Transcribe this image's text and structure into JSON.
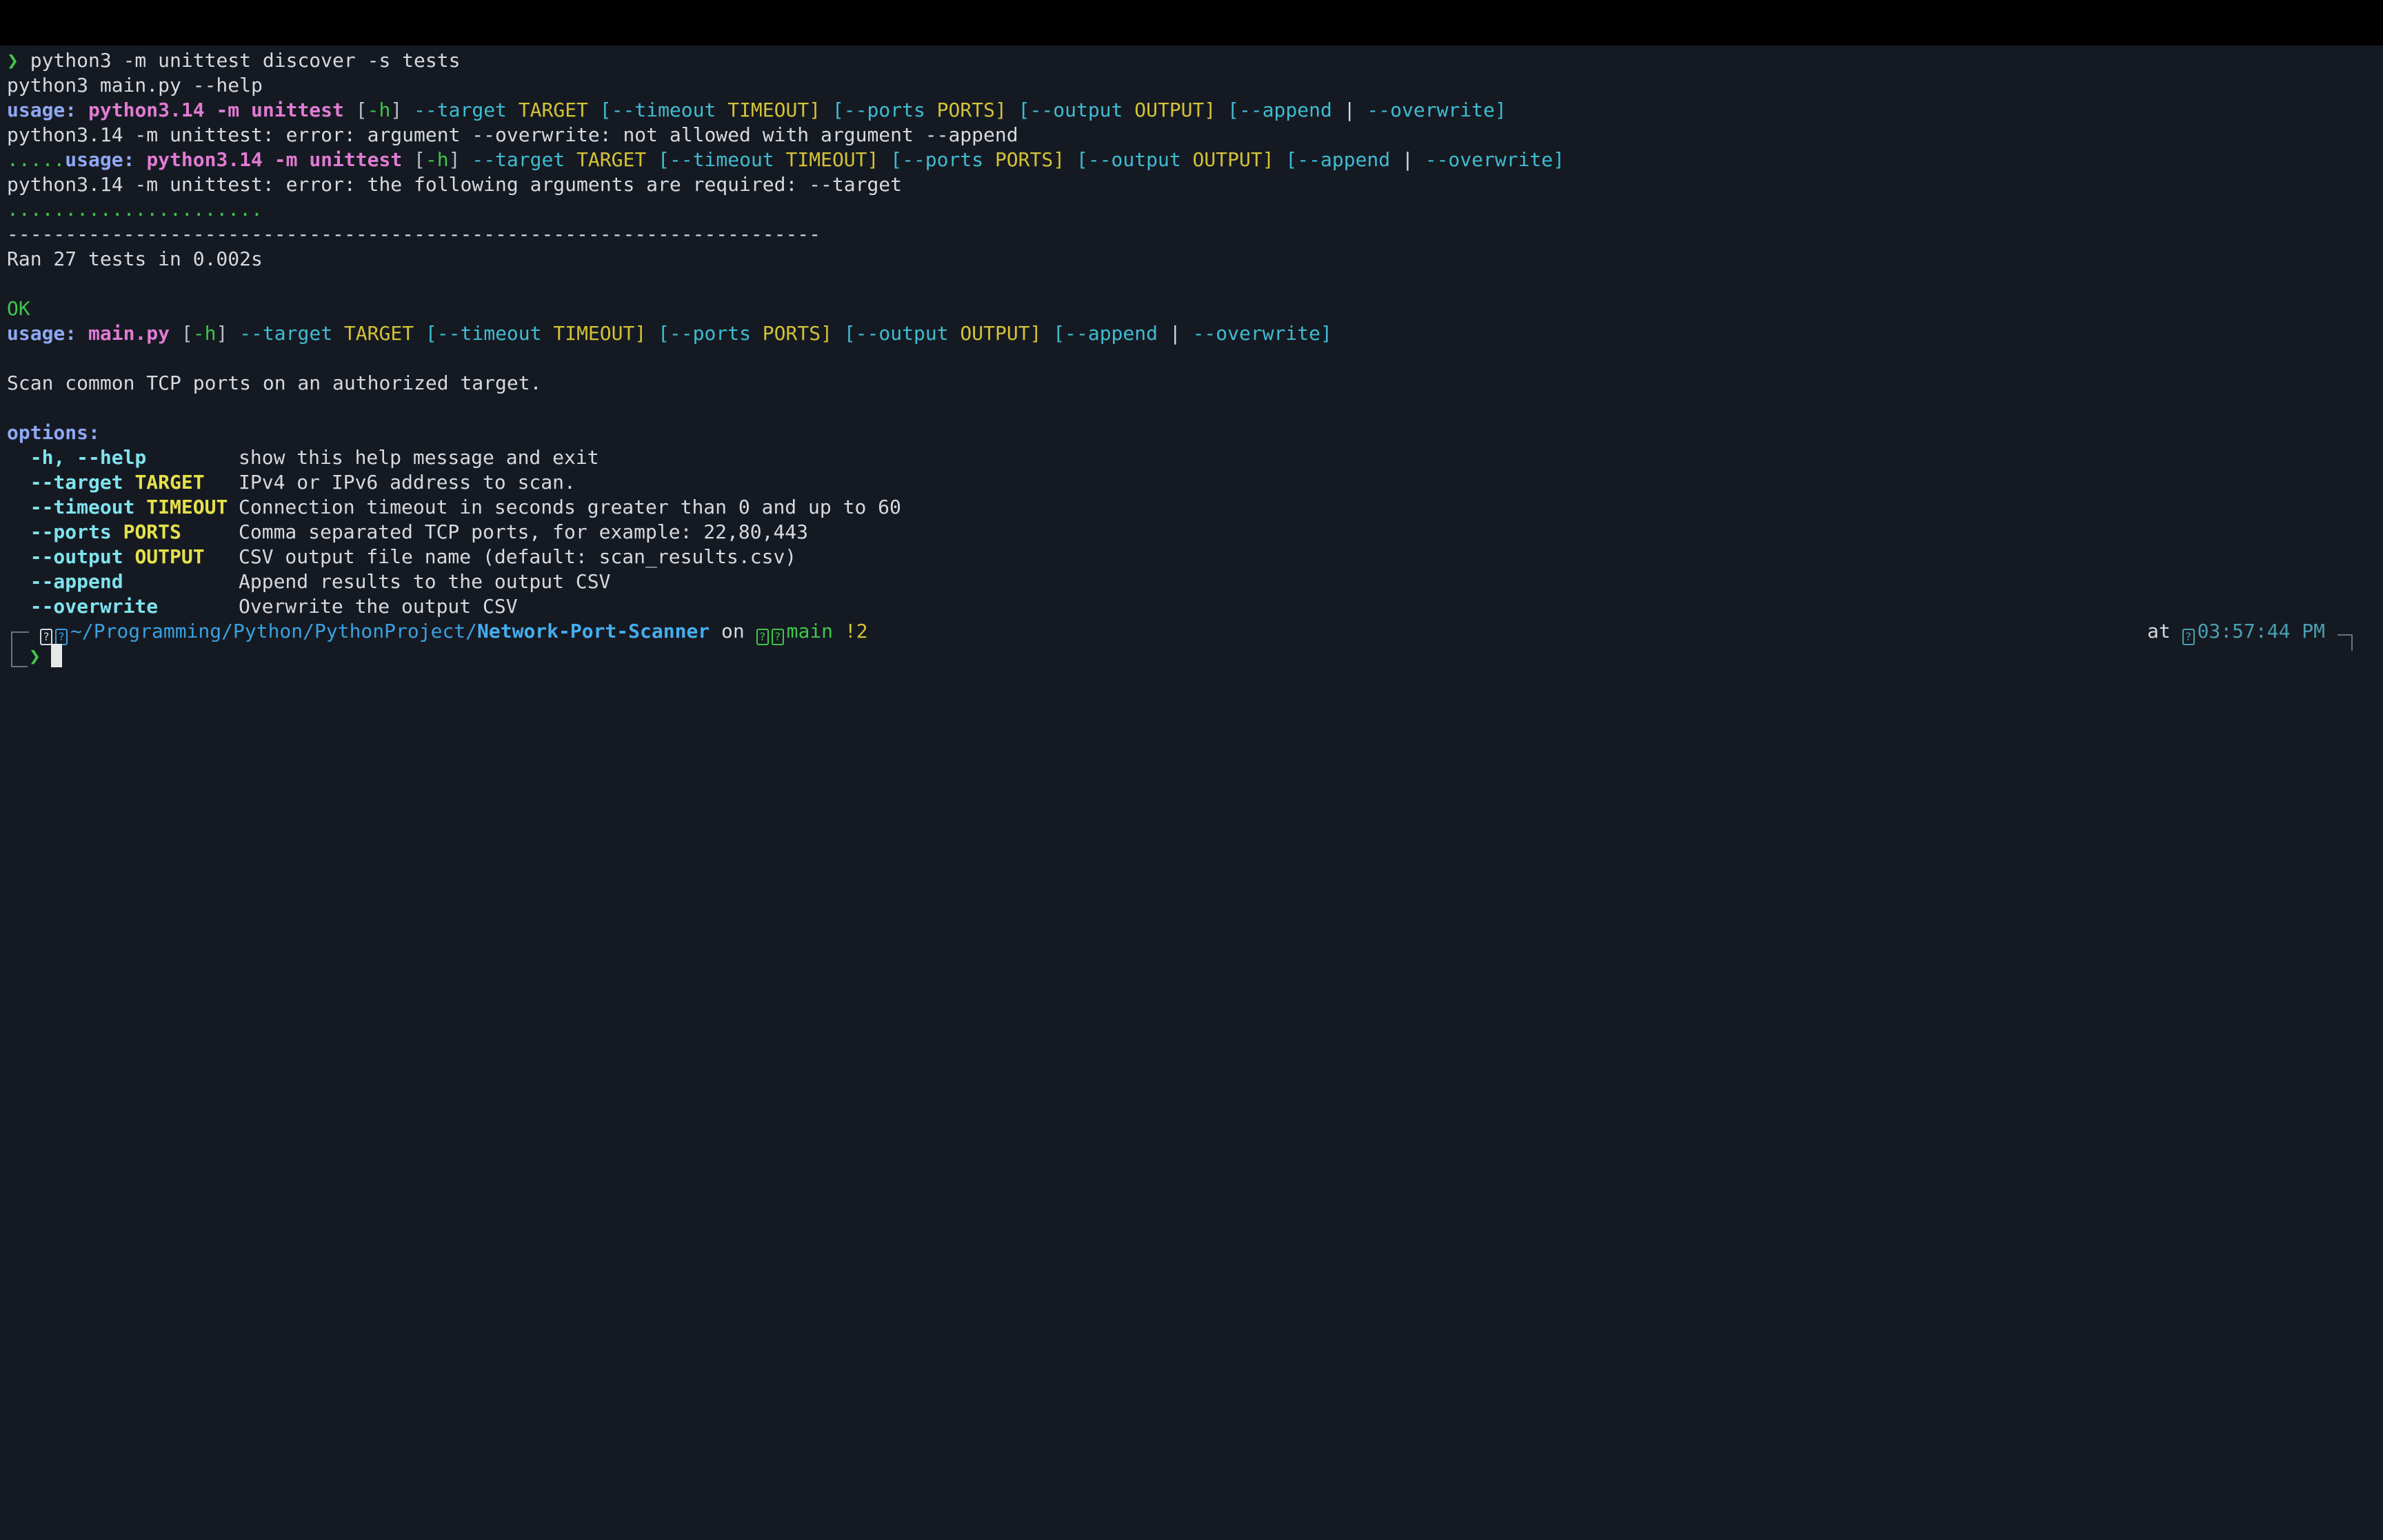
{
  "terminal": {
    "cmd1_prompt": "❯",
    "cmd1": "python3 -m unittest discover -s tests",
    "cmd2": "python3 main.py --help",
    "usage_label": "usage:",
    "prog_unittest": "python3.14 -m unittest",
    "prog_main": "main.py",
    "opt_h": "[-h]",
    "opt_target": "--target",
    "meta_target": "TARGET",
    "opt_timeout_open": "[--timeout",
    "meta_timeout_close": "TIMEOUT]",
    "opt_ports_open": "[--ports",
    "meta_ports_close": "PORTS]",
    "opt_output_open": "[--output",
    "meta_output_close": "OUTPUT]",
    "opt_append_open": "[--append",
    "pipe": "|",
    "opt_overwrite_close": "--overwrite]",
    "err1": "python3.14 -m unittest: error: argument --overwrite: not allowed with argument --append",
    "dots_prefix": ".....",
    "err2": "python3.14 -m unittest: error: the following arguments are required: --target",
    "dots_line": "......................",
    "separator": "----------------------------------------------------------------------",
    "ran": "Ran 27 tests in 0.002s",
    "ok": "OK",
    "description": "Scan common TCP ports on an authorized target.",
    "options_header": "options:",
    "options": [
      {
        "flag": "-h, --help",
        "meta": "",
        "help": "show this help message and exit"
      },
      {
        "flag": "--target",
        "meta": "TARGET",
        "help": "IPv4 or IPv6 address to scan."
      },
      {
        "flag": "--timeout",
        "meta": "TIMEOUT",
        "help": "Connection timeout in seconds greater than 0 and up to 60"
      },
      {
        "flag": "--ports",
        "meta": "PORTS",
        "help": "Comma separated TCP ports, for example: 22,80,443"
      },
      {
        "flag": "--output",
        "meta": "OUTPUT",
        "help": "CSV output file name (default: scan_results.csv)"
      },
      {
        "flag": "--append",
        "meta": "",
        "help": "Append results to the output CSV"
      },
      {
        "flag": "--overwrite",
        "meta": "",
        "help": "Overwrite the output CSV"
      }
    ],
    "prompt": {
      "path_prefix": "~/Programming/Python/PythonProject/",
      "path_dir": "Network-Port-Scanner",
      "on": "on",
      "branch": "main",
      "git_status": "!2",
      "at": "at",
      "time": "03:57:44 PM",
      "input_caret": "❯",
      "unknown_glyph": "?"
    }
  },
  "colors": {
    "background": "#151a22",
    "titlebar": "#000000",
    "usage": "#8fa8f4",
    "program": "#e07bd3",
    "option": "#3fbcd2",
    "metavar": "#d4c236",
    "success": "#3fc64a",
    "path": "#3aa0e0"
  }
}
